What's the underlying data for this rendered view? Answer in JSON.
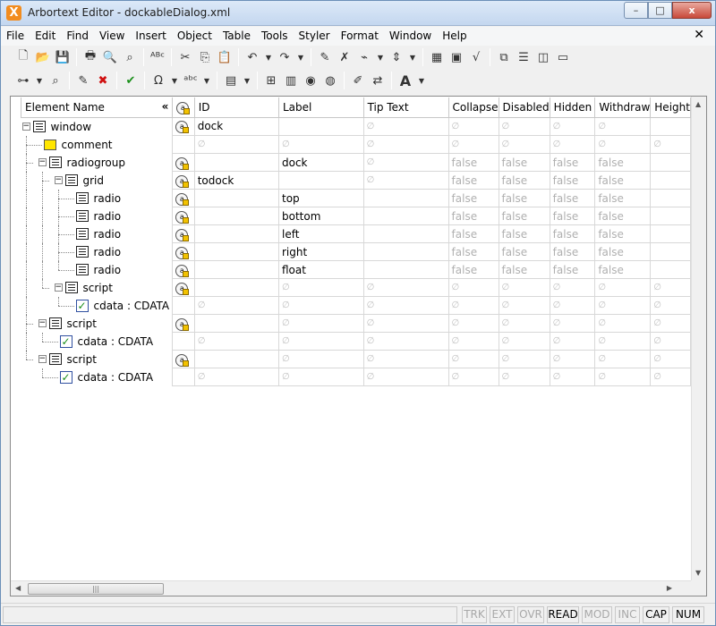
{
  "window": {
    "title": "Arbortext Editor - dockableDialog.xml",
    "app_icon_glyph": "X",
    "buttons": {
      "minimize": "–",
      "maximize": "□",
      "close": "x"
    }
  },
  "menu": {
    "items": [
      "File",
      "Edit",
      "Find",
      "View",
      "Insert",
      "Object",
      "Table",
      "Tools",
      "Styler",
      "Format",
      "Window",
      "Help"
    ],
    "close_glyph": "✕"
  },
  "toolbar1": {
    "icons": [
      "new-document-icon",
      "open-folder-icon",
      "save-icon",
      "print-icon",
      "print-preview-icon",
      "find-binoculars-icon",
      "spell-check-icon",
      "cut-icon",
      "copy-icon",
      "paste-icon",
      "undo-icon",
      "redo-icon",
      "insert-markup-icon",
      "delete-markup-icon",
      "tag-icon",
      "line-spacing-icon",
      "table-icon",
      "graphic-icon",
      "equation-icon",
      "preview-icon",
      "document-map-icon",
      "split-view-icon",
      "window-icon"
    ]
  },
  "toolbar2": {
    "icons": [
      "element-tree-icon",
      "find-element-icon",
      "edit-element-icon",
      "delete-element-icon",
      "check-completeness-icon",
      "special-characters-icon",
      "spell-icon",
      "text-icon",
      "insert-line-icon",
      "publish-icon",
      "web-icon",
      "pdf-icon",
      "modify-attributes-icon",
      "change-markup-icon",
      "font-size-icon"
    ]
  },
  "grid": {
    "columns": [
      "Element Name",
      "",
      "ID",
      "Label",
      "Tip Text",
      "Collapse",
      "Disabled",
      "Hidden",
      "Withdraw",
      "Height"
    ],
    "collapse_glyph": "«",
    "null_glyph": "∅",
    "false_text": "false",
    "rows": [
      {
        "depth": 0,
        "kind": "element",
        "name": "window",
        "expander": "−",
        "attr_icon": true,
        "id": "dock",
        "label": "",
        "tip": "null",
        "collapse": "null",
        "disabled": "null",
        "hidden": "null",
        "withdraw": "null",
        "height": ""
      },
      {
        "depth": 1,
        "kind": "comment",
        "name": "comment",
        "expander": "",
        "attr_icon": false,
        "id": "null",
        "label": "null",
        "tip": "null",
        "collapse": "null",
        "disabled": "null",
        "hidden": "null",
        "withdraw": "null",
        "height": "null"
      },
      {
        "depth": 1,
        "kind": "element",
        "name": "radiogroup",
        "expander": "−",
        "attr_icon": true,
        "id": "",
        "label": "dock",
        "tip": "null",
        "collapse": "false",
        "disabled": "false",
        "hidden": "false",
        "withdraw": "false",
        "height": ""
      },
      {
        "depth": 2,
        "kind": "element",
        "name": "grid",
        "expander": "−",
        "attr_icon": true,
        "id": "todock",
        "label": "",
        "tip": "null",
        "collapse": "false",
        "disabled": "false",
        "hidden": "false",
        "withdraw": "false",
        "height": ""
      },
      {
        "depth": 3,
        "kind": "element",
        "name": "radio",
        "expander": "",
        "attr_icon": true,
        "id": "",
        "label": "top",
        "tip": "",
        "collapse": "false",
        "disabled": "false",
        "hidden": "false",
        "withdraw": "false",
        "height": ""
      },
      {
        "depth": 3,
        "kind": "element",
        "name": "radio",
        "expander": "",
        "attr_icon": true,
        "id": "",
        "label": "bottom",
        "tip": "",
        "collapse": "false",
        "disabled": "false",
        "hidden": "false",
        "withdraw": "false",
        "height": ""
      },
      {
        "depth": 3,
        "kind": "element",
        "name": "radio",
        "expander": "",
        "attr_icon": true,
        "id": "",
        "label": "left",
        "tip": "",
        "collapse": "false",
        "disabled": "false",
        "hidden": "false",
        "withdraw": "false",
        "height": ""
      },
      {
        "depth": 3,
        "kind": "element",
        "name": "radio",
        "expander": "",
        "attr_icon": true,
        "id": "",
        "label": "right",
        "tip": "",
        "collapse": "false",
        "disabled": "false",
        "hidden": "false",
        "withdraw": "false",
        "height": ""
      },
      {
        "depth": 3,
        "kind": "element",
        "name": "radio",
        "expander": "",
        "attr_icon": true,
        "id": "",
        "label": "float",
        "tip": "",
        "collapse": "false",
        "disabled": "false",
        "hidden": "false",
        "withdraw": "false",
        "height": ""
      },
      {
        "depth": 2,
        "kind": "element",
        "name": "script",
        "expander": "−",
        "attr_icon": true,
        "id": "",
        "label": "null",
        "tip": "null",
        "collapse": "null",
        "disabled": "null",
        "hidden": "null",
        "withdraw": "null",
        "height": "null"
      },
      {
        "depth": 3,
        "kind": "cdata",
        "name": "cdata : CDATA",
        "expander": "",
        "attr_icon": false,
        "id": "null",
        "label": "null",
        "tip": "null",
        "collapse": "null",
        "disabled": "null",
        "hidden": "null",
        "withdraw": "null",
        "height": "null"
      },
      {
        "depth": 1,
        "kind": "element",
        "name": "script",
        "expander": "−",
        "attr_icon": true,
        "id": "",
        "label": "null",
        "tip": "null",
        "collapse": "null",
        "disabled": "null",
        "hidden": "null",
        "withdraw": "null",
        "height": "null"
      },
      {
        "depth": 2,
        "kind": "cdata",
        "name": "cdata : CDATA",
        "expander": "",
        "attr_icon": false,
        "id": "null",
        "label": "null",
        "tip": "null",
        "collapse": "null",
        "disabled": "null",
        "hidden": "null",
        "withdraw": "null",
        "height": "null"
      },
      {
        "depth": 1,
        "kind": "element",
        "name": "script",
        "expander": "−",
        "attr_icon": true,
        "id": "",
        "label": "null",
        "tip": "null",
        "collapse": "null",
        "disabled": "null",
        "hidden": "null",
        "withdraw": "null",
        "height": "null"
      },
      {
        "depth": 2,
        "kind": "cdata",
        "name": "cdata : CDATA",
        "expander": "",
        "attr_icon": false,
        "id": "null",
        "label": "null",
        "tip": "null",
        "collapse": "null",
        "disabled": "null",
        "hidden": "null",
        "withdraw": "null",
        "height": "null"
      }
    ]
  },
  "statusbar": {
    "indicators": [
      {
        "label": "TRK",
        "active": false
      },
      {
        "label": "EXT",
        "active": false
      },
      {
        "label": "OVR",
        "active": false
      },
      {
        "label": "READ",
        "active": true
      },
      {
        "label": "MOD",
        "active": false
      },
      {
        "label": "INC",
        "active": false
      },
      {
        "label": "CAP",
        "active": true
      },
      {
        "label": "NUM",
        "active": true
      }
    ]
  }
}
